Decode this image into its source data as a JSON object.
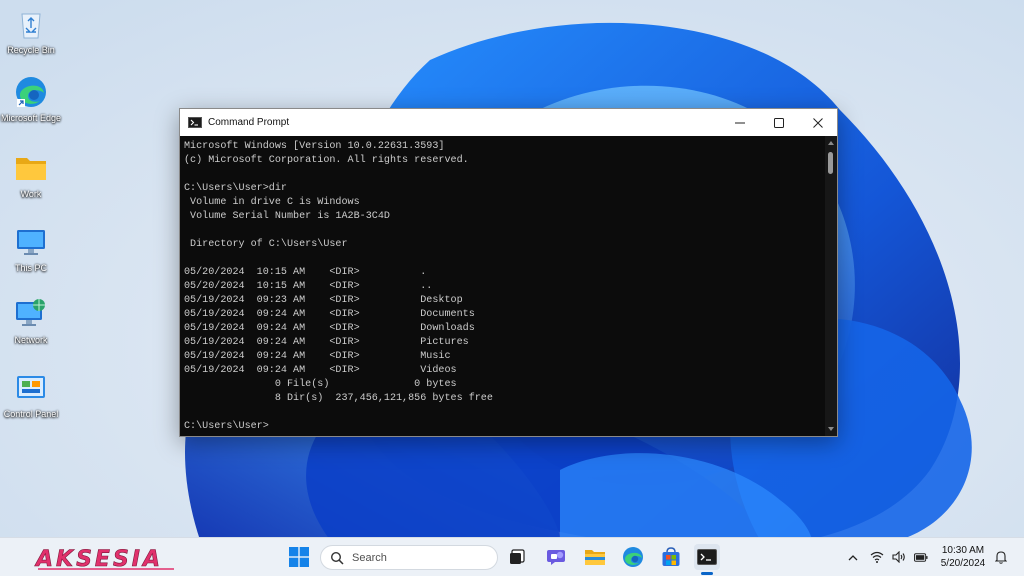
{
  "desktop": {
    "icons": [
      {
        "label": "Recycle Bin",
        "icon": "recycle-bin-icon"
      },
      {
        "label": "Microsoft Edge",
        "icon": "edge-icon"
      },
      {
        "label": "Work",
        "icon": "folder-icon"
      },
      {
        "label": "This PC",
        "icon": "monitor-icon"
      },
      {
        "label": "Network",
        "icon": "network-icon"
      },
      {
        "label": "Control Panel",
        "icon": "control-panel-icon"
      }
    ]
  },
  "window": {
    "title": "Command Prompt",
    "icon": "cmd-icon",
    "controls": [
      "minimize-icon",
      "maximize-icon",
      "close-icon"
    ]
  },
  "terminal": {
    "lines": [
      "Microsoft Windows [Version 10.0.22631.3593]",
      "(c) Microsoft Corporation. All rights reserved.",
      "",
      "C:\\Users\\User>dir",
      " Volume in drive C is Windows",
      " Volume Serial Number is 1A2B-3C4D",
      "",
      " Directory of C:\\Users\\User",
      "",
      "05/20/2024  10:15 AM    <DIR>          .",
      "05/20/2024  10:15 AM    <DIR>          ..",
      "05/19/2024  09:23 AM    <DIR>          Desktop",
      "05/19/2024  09:24 AM    <DIR>          Documents",
      "05/19/2024  09:24 AM    <DIR>          Downloads",
      "05/19/2024  09:24 AM    <DIR>          Pictures",
      "05/19/2024  09:24 AM    <DIR>          Music",
      "05/19/2024  09:24 AM    <DIR>          Videos",
      "               0 File(s)              0 bytes",
      "               8 Dir(s)  237,456,121,856 bytes free",
      "",
      "C:\\Users\\User>"
    ]
  },
  "taskbar": {
    "brand": "AKSESIA",
    "search_placeholder": "Search",
    "pinned": [
      "windows-start-icon",
      "task-view-icon",
      "teams-chat-icon",
      "file-explorer-icon",
      "edge-icon",
      "store-icon",
      "terminal-icon"
    ],
    "active": "terminal-icon",
    "tray": [
      "chevron-up-icon",
      "wifi-icon",
      "volume-icon",
      "battery-icon"
    ],
    "time": "10:30 AM",
    "date": "5/20/2024",
    "notification_icon": "bell-icon"
  },
  "colors": {
    "accent": "#0a65c8",
    "terminal_bg": "#0c0c0c",
    "terminal_text": "#cccccc",
    "brand": "#e1316c"
  }
}
